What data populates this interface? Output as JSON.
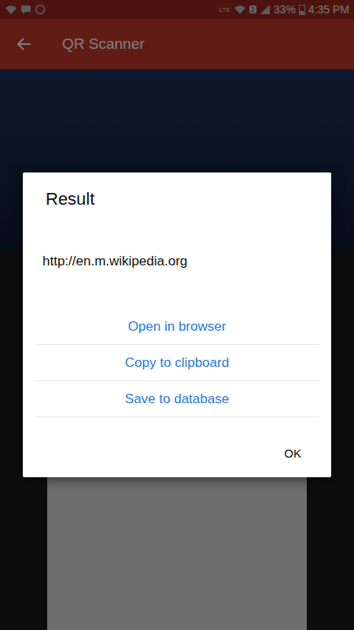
{
  "status_bar": {
    "time": "4:35 PM",
    "battery": "33%",
    "sim_badge": "2",
    "network": "LTE"
  },
  "app_bar": {
    "title": "QR Scanner"
  },
  "dialog": {
    "title": "Result",
    "content": "http://en.m.wikipedia.org",
    "actions": [
      "Open in browser",
      "Copy to clipboard",
      "Save to database"
    ],
    "buttons": [
      "OK"
    ]
  }
}
